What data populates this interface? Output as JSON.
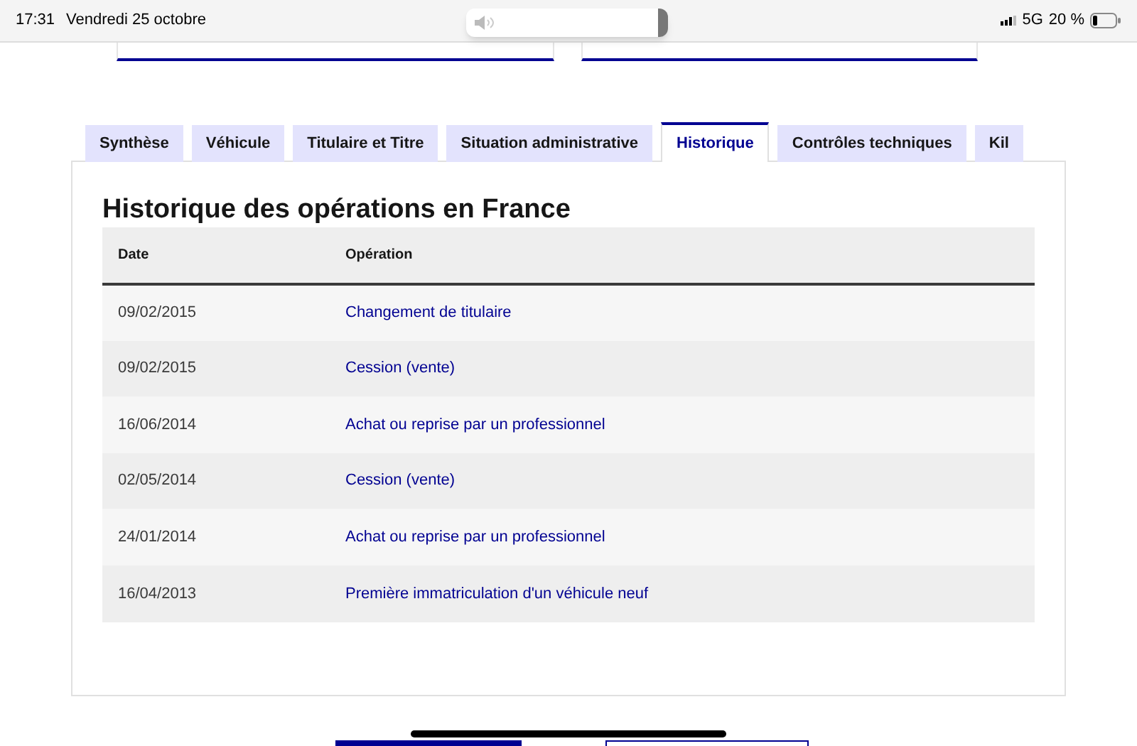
{
  "status_bar": {
    "time": "17:31",
    "date": "Vendredi 25 octobre",
    "network": "5G",
    "battery": "20 %"
  },
  "tabs": [
    {
      "label": "Synthèse",
      "selected": false
    },
    {
      "label": "Véhicule",
      "selected": false
    },
    {
      "label": "Titulaire et Titre",
      "selected": false
    },
    {
      "label": "Situation administrative",
      "selected": false
    },
    {
      "label": "Historique",
      "selected": true
    },
    {
      "label": "Contrôles techniques",
      "selected": false
    },
    {
      "label": "Kil",
      "selected": false
    }
  ],
  "section": {
    "title": "Historique des opérations en France",
    "table": {
      "columns": [
        "Date",
        "Opération"
      ],
      "rows": [
        {
          "date": "09/02/2015",
          "operation": "Changement de titulaire"
        },
        {
          "date": "09/02/2015",
          "operation": "Cession (vente)"
        },
        {
          "date": "16/06/2014",
          "operation": "Achat ou reprise par un professionnel"
        },
        {
          "date": "02/05/2014",
          "operation": "Cession (vente)"
        },
        {
          "date": "24/01/2014",
          "operation": "Achat ou reprise par un professionnel"
        },
        {
          "date": "16/04/2013",
          "operation": "Première immatriculation d'un véhicule neuf"
        }
      ]
    }
  }
}
